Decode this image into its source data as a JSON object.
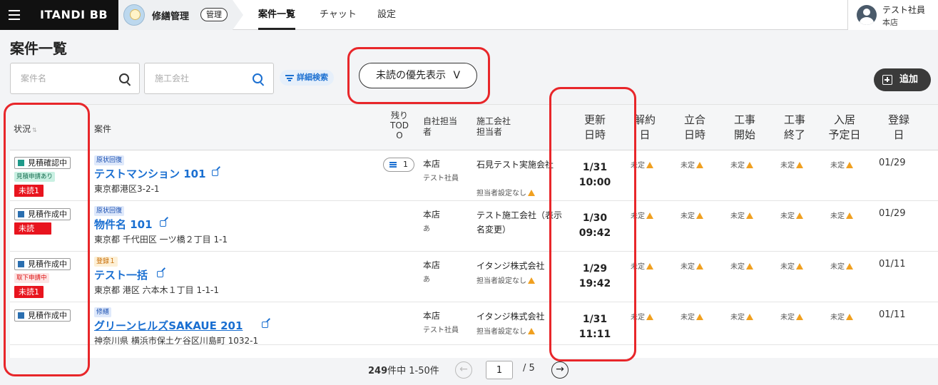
{
  "header": {
    "brand": "ITANDI BB",
    "app_name": "修繕管理",
    "app_badge": "管理",
    "nav": [
      "案件一覧",
      "チャット",
      "設定"
    ],
    "user_name": "テスト社員",
    "user_store": "本店"
  },
  "page": {
    "title": "案件一覧",
    "search_case_placeholder": "案件名",
    "search_contractor_placeholder": "施工会社",
    "advanced_search": "詳細検索",
    "unread_priority": "未読の優先表示",
    "unread_priority_arrow": "V",
    "add_label": "追加"
  },
  "table": {
    "headers": {
      "status": "状況",
      "status_sort": "⇅",
      "case": "案件",
      "todo": [
        "残り",
        "TOD",
        "O"
      ],
      "own": [
        "自社担当",
        "者"
      ],
      "contractor": [
        "施工会社",
        "担当者"
      ],
      "updated": [
        "更新",
        "日時"
      ],
      "contract": [
        "解約",
        "日"
      ],
      "inspection": [
        "立合",
        "日時"
      ],
      "start": [
        "工事",
        "開始"
      ],
      "end": [
        "工事",
        "終了"
      ],
      "movein": [
        "入居",
        "予定日"
      ],
      "registered": [
        "登録",
        "日"
      ]
    },
    "pending_label": "未定",
    "rows": [
      {
        "status": "見積確認中",
        "request": "見積申請あり",
        "unread": "未読1",
        "category": "原状回復",
        "name": "テストマンション 101",
        "address": "東京都港区3-2-1",
        "todo": "1",
        "own_store": "本店",
        "own_person": "テスト社員",
        "contractor": "石見テスト実施会社",
        "contractor_sub": "担当者設定なし",
        "updated_date": "1/31",
        "updated_time": "10:00",
        "registered": "01/29"
      },
      {
        "status": "見積作成中",
        "unread": "未読",
        "category": "原状回復",
        "name": "物件名 101",
        "address": "東京都 千代田区 一ツ橋２丁目 1-1",
        "own_store": "本店",
        "own_person": "あ",
        "contractor": "テスト施工会社（表示名変更）",
        "updated_date": "1/30",
        "updated_time": "09:42",
        "registered": "01/29"
      },
      {
        "status": "見積作成中",
        "request": "取下申請中",
        "unread": "未読1",
        "category": "登録１",
        "name": "テスト一括",
        "address": "東京都 港区 六本木１丁目 1-1-1",
        "own_store": "本店",
        "own_person": "あ",
        "contractor": "イタンジ株式会社",
        "contractor_sub": "担当者設定なし",
        "updated_date": "1/29",
        "updated_time": "19:42",
        "registered": "01/11"
      },
      {
        "status": "見積作成中",
        "category": "修繕",
        "name": "グリーンヒルズSAKAUE 201",
        "address": "神奈川県 横浜市保土ケ谷区川島町 1032-1",
        "own_store": "本店",
        "own_person": "テスト社員",
        "contractor": "イタンジ株式会社",
        "contractor_sub": "担当者設定なし",
        "updated_date": "1/31",
        "updated_time": "11:11",
        "registered": "01/11"
      }
    ]
  },
  "pagination": {
    "total": "249",
    "total_suffix": "件中 1-50件",
    "current_page": "1",
    "total_pages": "/ 5",
    "prev": "←",
    "next": "→"
  },
  "colors": {
    "accent_blue": "#1a6fd1",
    "unread_red": "#e8141e",
    "annotation_red": "#e8262a"
  }
}
